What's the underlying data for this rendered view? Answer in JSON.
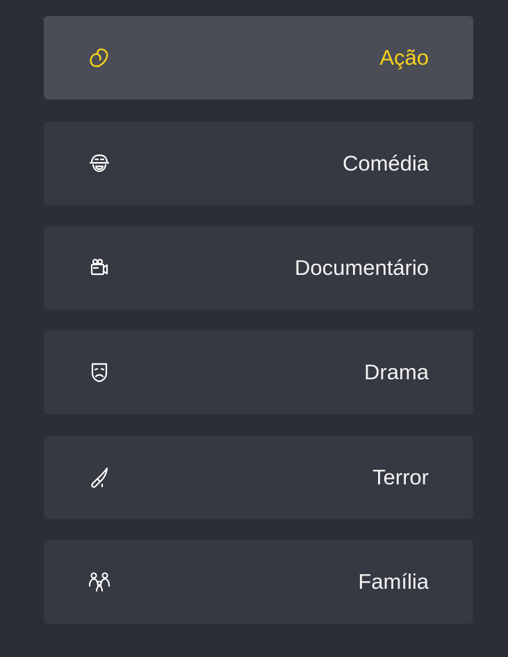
{
  "genres": {
    "active_color": "#f7d21a",
    "text_color": "#f2f2f2",
    "items": [
      {
        "label": "Ação",
        "icon": "boxing-glove-icon",
        "active": true
      },
      {
        "label": "Comédia",
        "icon": "laughing-face-icon",
        "active": false
      },
      {
        "label": "Documentário",
        "icon": "video-camera-icon",
        "active": false
      },
      {
        "label": "Drama",
        "icon": "sad-mask-icon",
        "active": false
      },
      {
        "label": "Terror",
        "icon": "knife-icon",
        "active": false
      },
      {
        "label": "Família",
        "icon": "family-icon",
        "active": false
      }
    ]
  }
}
